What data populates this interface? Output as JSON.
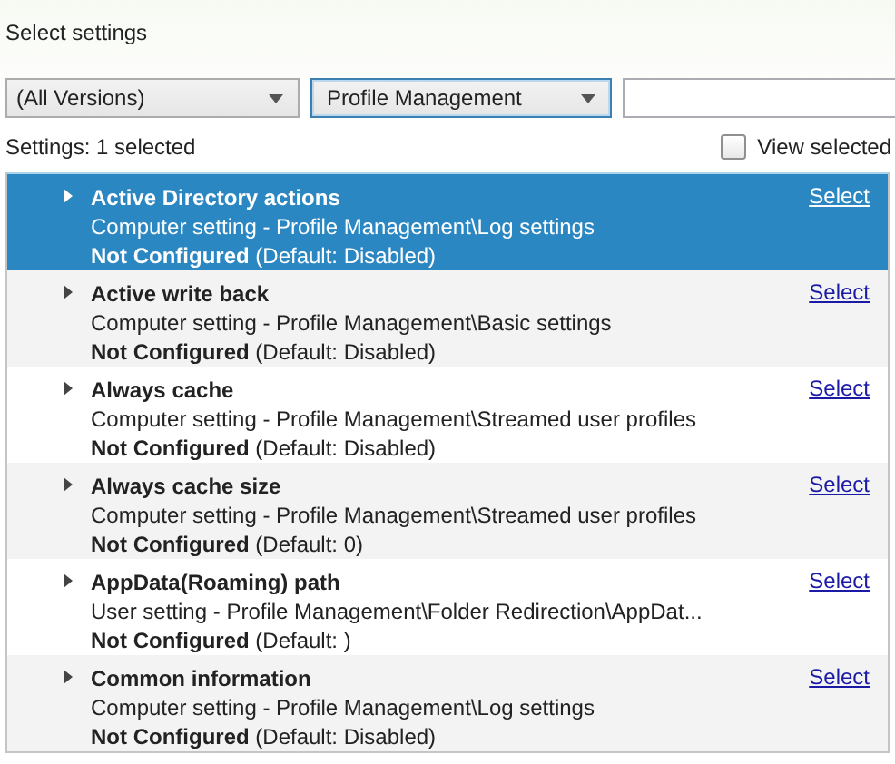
{
  "heading": "Select settings",
  "filters": {
    "version": "(All Versions)",
    "category": "Profile Management"
  },
  "summary": {
    "label": "Settings:",
    "count": "1 selected"
  },
  "view_selected": {
    "label": "View selected",
    "checked": false
  },
  "settings": [
    {
      "name": "Active Directory actions",
      "path": "Computer setting - Profile Management\\Log settings",
      "state": "**Not Configured** (Default: Disabled)",
      "link": "Select",
      "selected": true
    },
    {
      "name": "Active write back",
      "path": "Computer setting - Profile Management\\Basic settings",
      "state": "**Not Configured** (Default: Disabled)",
      "link": "Select",
      "selected": false
    },
    {
      "name": "Always cache",
      "path": "Computer setting - Profile Management\\Streamed user profiles",
      "state": "**Not Configured** (Default: Disabled)",
      "link": "Select",
      "selected": false
    },
    {
      "name": "Always cache size",
      "path": "Computer setting - Profile Management\\Streamed user profiles",
      "state": "**Not Configured** (Default: 0)",
      "link": "Select",
      "selected": false
    },
    {
      "name": "AppData(Roaming) path",
      "path": "User setting - Profile Management\\Folder Redirection\\AppDat...",
      "state": "**Not Configured** (Default: )",
      "link": "Select",
      "selected": false
    },
    {
      "name": "Common information",
      "path": "Computer setting - Profile Management\\Log settings",
      "state": "**Not Configured** (Default: Disabled)",
      "link": "Select",
      "selected": false
    }
  ]
}
